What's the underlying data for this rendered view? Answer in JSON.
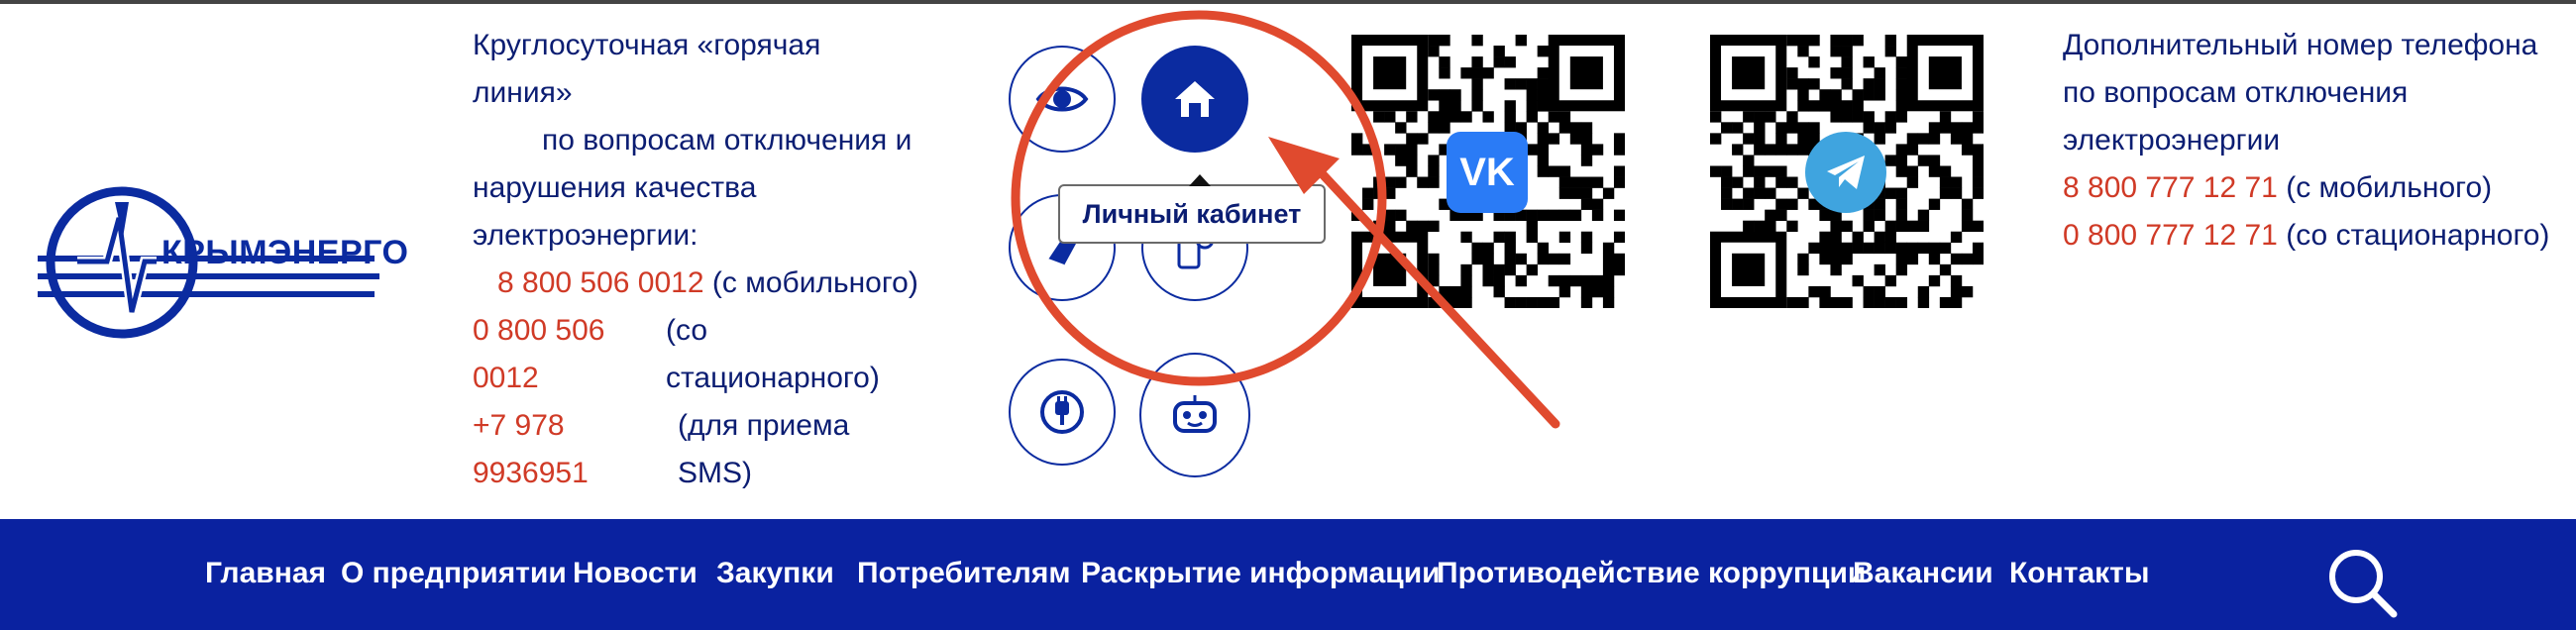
{
  "logo": {
    "text": "КРЫМЭНЕРГО"
  },
  "hotline": {
    "line1": "Круглосуточная «горячая",
    "line2": "линия»",
    "line3": "по вопросам отключения и",
    "line4": "нарушения качества",
    "line5": "электроэнергии:",
    "phone_mobile": "8 800 506 0012",
    "phone_mobile_note": "(с мобильного)",
    "phone_landline_a": "0 800 506",
    "phone_landline_b": "0012",
    "phone_landline_note_a": "(со",
    "phone_landline_note_b": "стационарного)",
    "phone_sms_a": "+7 978",
    "phone_sms_b": "9936951",
    "phone_sms_note_a": "(для приема",
    "phone_sms_note_b": "SMS)"
  },
  "quick_buttons": {
    "tooltip": "Личный кабинет",
    "icons": [
      "eye-icon",
      "home-icon",
      "clean-brush-icon",
      "phone-settings-icon",
      "plug-icon",
      "robot-icon"
    ]
  },
  "qr": {
    "vk_badge": "VK",
    "vk_color": "#2a7bf6",
    "tg_color": "#3fa4df"
  },
  "extra": {
    "line1": "Дополнительный номер телефона",
    "line2": "по вопросам отключения",
    "line3": "электроэнергии",
    "phone_mobile": "8 800 777 12 71",
    "phone_mobile_note": "(с мобильного)",
    "phone_landline": "0 800 777 12 71",
    "phone_landline_note": "(со стационарного)"
  },
  "nav": {
    "items": [
      "Главная",
      "О предприятии",
      "Новости",
      "Закупки",
      "Потребителям",
      "Раскрытие информации",
      "Противодействие коррупции",
      "Вакансии",
      "Контакты"
    ]
  },
  "colors": {
    "brand": "#0a22a0",
    "accent_red": "#d03a26",
    "annotation": "#e04a2e"
  }
}
